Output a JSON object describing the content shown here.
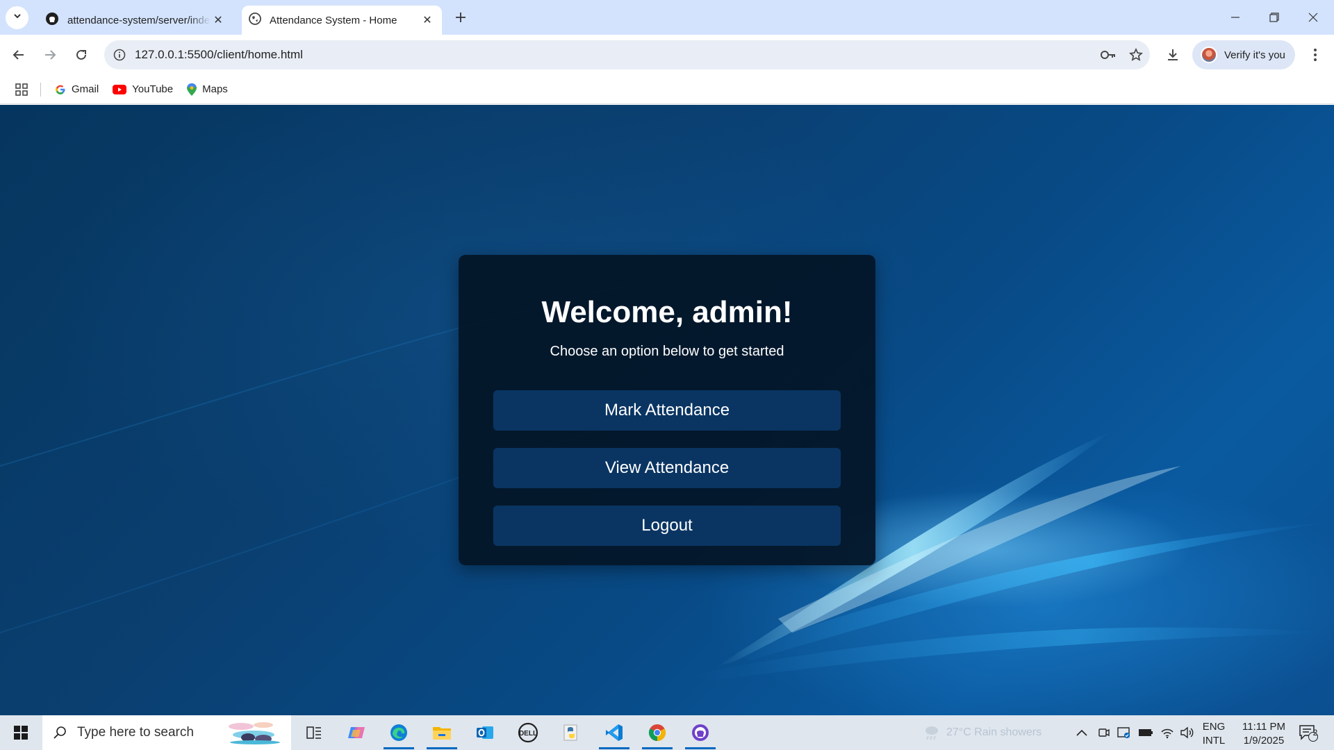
{
  "browser": {
    "tabs": [
      {
        "title": "attendance-system/server/index.js",
        "icon": "github-icon",
        "active": false
      },
      {
        "title": "Attendance System - Home",
        "icon": "globe-icon",
        "active": true
      }
    ],
    "url": "127.0.0.1:5500/client/home.html",
    "profile_label": "Verify it's you",
    "bookmarks": [
      {
        "label": "Gmail",
        "icon": "google-icon"
      },
      {
        "label": "YouTube",
        "icon": "youtube-icon"
      },
      {
        "label": "Maps",
        "icon": "maps-pin-icon"
      }
    ]
  },
  "page": {
    "heading": "Welcome, admin!",
    "subtitle": "Choose an option below to get started",
    "buttons": {
      "mark": "Mark Attendance",
      "view": "View Attendance",
      "logout": "Logout"
    }
  },
  "taskbar": {
    "search_placeholder": "Type here to search",
    "weather": "27°C  Rain showers",
    "lang_top": "ENG",
    "lang_bottom": "INTL",
    "time": "11:11 PM",
    "date": "1/9/2025",
    "notification_count": "2"
  },
  "colors": {
    "card_bg": "#041628",
    "button_bg": "#0a3563",
    "tab_strip": "#d3e3fd"
  }
}
